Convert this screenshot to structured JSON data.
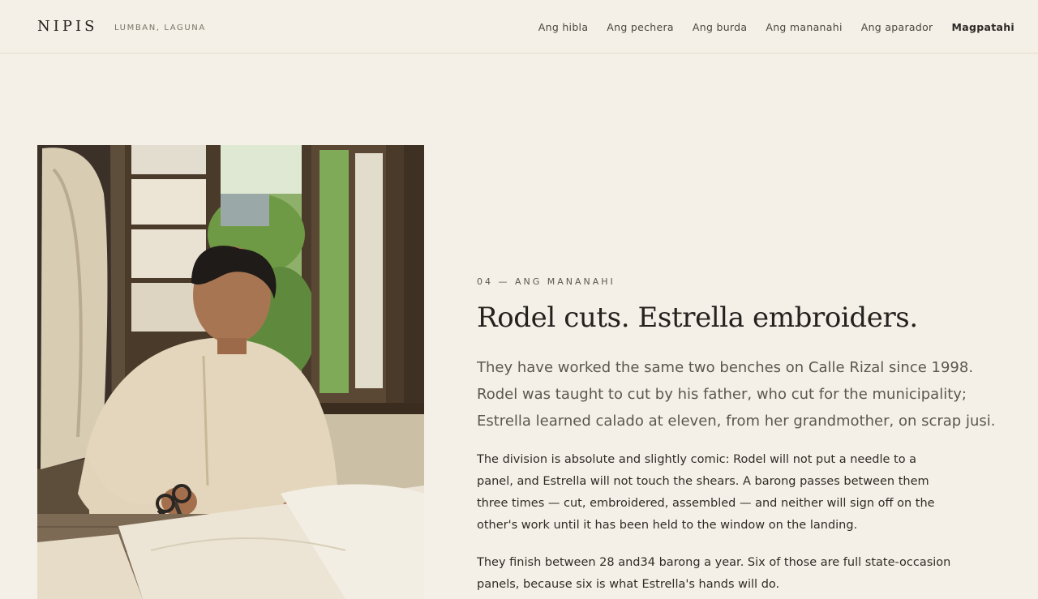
{
  "header": {
    "brand": "NIPIS",
    "location": "LUMBAN, LAGUNA",
    "nav": [
      {
        "label": "Ang hibla"
      },
      {
        "label": "Ang pechera"
      },
      {
        "label": "Ang burda"
      },
      {
        "label": "Ang mananahi"
      },
      {
        "label": "Ang aparador"
      },
      {
        "label": "Magpatahi"
      }
    ]
  },
  "article": {
    "eyebrow": "04 — ANG MANANAHI",
    "title": "Rodel cuts. Estrella embroiders.",
    "lede": "They have worked the same two benches on Calle Rizal since 1998. Rodel was taught to cut by his father, who cut for the municipality; Estrella learned calado at eleven, from her grandmother, on scrap jusi.",
    "paragraphs": [
      "The division is absolute and slightly comic: Rodel will not put a needle to a panel, and Estrella will not touch the shears. A barong passes between them three times — cut, embroidered, assembled — and neither will sign off on the other's work until it has been held to the window on the landing.",
      "They finish between 28 and34 barong a year. Six of those are full state-occasion panels, because six is what Estrella's hands will do."
    ]
  },
  "colors": {
    "background": "#f5f0e7",
    "text": "#2b2925",
    "muted": "#5b5750"
  }
}
